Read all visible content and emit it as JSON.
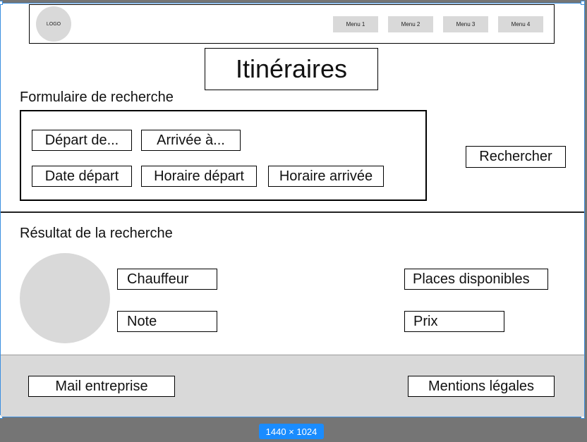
{
  "header": {
    "logo": "LOGO",
    "menu": [
      "Menu 1",
      "Menu 2",
      "Menu 3",
      "Menu 4"
    ]
  },
  "page_title": "Itinéraires",
  "search": {
    "section_label": "Formulaire de recherche",
    "depart": "Départ de...",
    "arrivee": "Arrivée à...",
    "date_depart": "Date départ",
    "horaire_depart": "Horaire départ",
    "horaire_arrivee": "Horaire arrivée",
    "button": "Rechercher"
  },
  "results": {
    "section_label": "Résultat de la recherche",
    "chauffeur": "Chauffeur",
    "note": "Note",
    "places": "Places disponibles",
    "prix": "Prix"
  },
  "footer": {
    "mail": "Mail entreprise",
    "mentions": "Mentions légales"
  },
  "canvas": {
    "dimension_badge": "1440 × 1024",
    "selection_color": "#3b8fe0",
    "badge_color": "#1a8cff"
  }
}
